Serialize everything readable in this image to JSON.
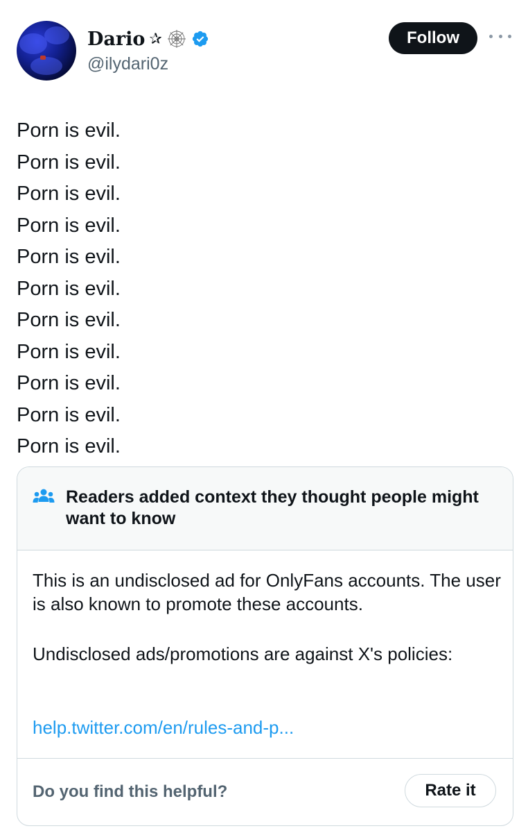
{
  "user": {
    "name": "Dario",
    "star": "✰",
    "handle": "@ilydari0z"
  },
  "follow_label": "Follow",
  "post": {
    "lines": [
      "Porn is evil.",
      "Porn is evil.",
      "Porn is evil.",
      "Porn is evil.",
      "Porn is evil.",
      "Porn is evil.",
      "Porn is evil.",
      "Porn is evil.",
      "Porn is evil.",
      "Porn is evil.",
      "Porn is evil."
    ]
  },
  "community_note": {
    "title": "Readers added context they thought people might want to know",
    "paragraph1": "This is an undisclosed ad for OnlyFans accounts. The user is also known to promote these accounts.",
    "paragraph2": "Undisclosed ads/promotions are against X's policies:",
    "link_text": "help.twitter.com/en/rules-and-p...",
    "helpful_prompt": "Do you find this helpful?",
    "rate_label": "Rate it"
  },
  "colors": {
    "accent": "#1d9bf0",
    "text_primary": "#0f1419",
    "text_secondary": "#536471",
    "border": "#cfd9de",
    "note_header_bg": "#f7f9f9"
  },
  "icons": [
    "verified-badge-icon",
    "spider-web-icon",
    "more-options-icon",
    "people-icon"
  ]
}
